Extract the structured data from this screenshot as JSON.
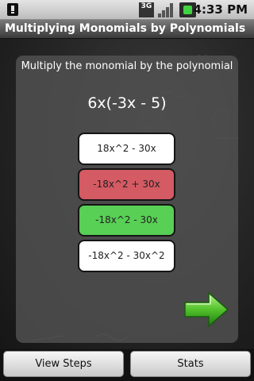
{
  "status_bar": {
    "network_label": "3G",
    "time": "4:33 PM",
    "left_icon": "notification-alert-icon",
    "battery_color": "#3fd33f"
  },
  "title": "Multiplying Monomials by Polynomials",
  "main": {
    "prompt": "Multiply the monomial by the polynomial",
    "problem": "6x(-3x - 5)",
    "answers": [
      {
        "label": "18x^2 - 30x",
        "state": "neutral",
        "color": "#ffffff"
      },
      {
        "label": "-18x^2 + 30x",
        "state": "incorrect",
        "color": "#d45a63"
      },
      {
        "label": "-18x^2 - 30x",
        "state": "correct",
        "color": "#58cf55"
      },
      {
        "label": "-18x^2 - 30x^2",
        "state": "neutral",
        "color": "#ffffff"
      }
    ],
    "next_icon": "green-right-arrow-icon"
  },
  "buttons": {
    "view_steps": "View Steps",
    "stats": "Stats"
  }
}
